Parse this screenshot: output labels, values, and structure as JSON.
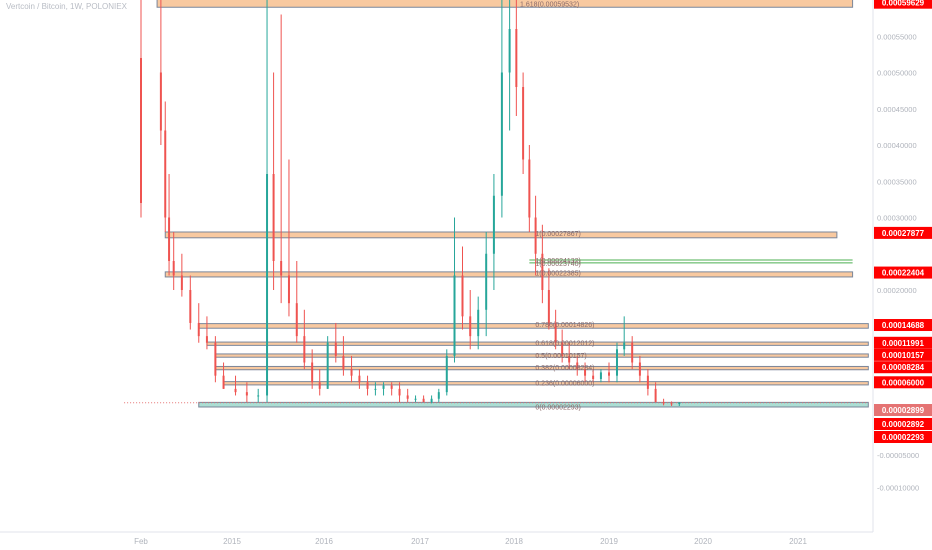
{
  "header": {
    "title": "Vertcoin / Bitcoin, 1W, POLONIEX"
  },
  "colors": {
    "background": "#ffffff",
    "up_candle": "#26a69a",
    "down_candle": "#ef5350",
    "zone_fill": "#f7c08f",
    "zone_border": "#7a869a",
    "support_fill": "#8fd3c4",
    "price_tag": "#ff0000",
    "fib_text": "#8a6a6a",
    "axis_text": "#b0b4bc",
    "grid": "#ffffff"
  },
  "chart_data": {
    "type": "candlestick",
    "title": "Vertcoin / Bitcoin, 1W, POLONIEX",
    "xlabel": "",
    "ylabel": "",
    "grid": false,
    "ylim": [
      -0.00012,
      0.00062
    ],
    "x_ticks": [
      {
        "label": "Feb",
        "date": "2014-02-01"
      },
      {
        "label": "2015",
        "date": "2015-01-01"
      },
      {
        "label": "2016",
        "date": "2016-01-01"
      },
      {
        "label": "2017",
        "date": "2017-01-01"
      },
      {
        "label": "2018",
        "date": "2018-01-01"
      },
      {
        "label": "2019",
        "date": "2019-01-01"
      },
      {
        "label": "2020",
        "date": "2020-01-01"
      },
      {
        "label": "2021",
        "date": "2021-01-01"
      }
    ],
    "y_ticks": [
      {
        "label": "0.00055000",
        "value": 0.00055
      },
      {
        "label": "0.00050000",
        "value": 0.0005
      },
      {
        "label": "0.00045000",
        "value": 0.00045
      },
      {
        "label": "0.00040000",
        "value": 0.0004
      },
      {
        "label": "0.00035000",
        "value": 0.00035
      },
      {
        "label": "0.00030000",
        "value": 0.0003
      },
      {
        "label": "0.00020000",
        "value": 0.0002
      },
      {
        "label": "-0.00005000",
        "value": -5e-05
      },
      {
        "label": "-0.00010000",
        "value": -0.0001
      }
    ],
    "price_tags": [
      {
        "label": "0.00059629",
        "value": 0.00059629,
        "color": "#ff0000"
      },
      {
        "label": "0.00027877",
        "value": 0.00027877,
        "color": "#ff0000"
      },
      {
        "label": "0.00022404",
        "value": 0.00022404,
        "color": "#ff0000"
      },
      {
        "label": "0.00014688",
        "value": 0.00014688,
        "color": "#ff0000"
      },
      {
        "label": "0.00011991",
        "value": 0.00011991,
        "color": "#ff0000"
      },
      {
        "label": "0.00010157",
        "value": 0.00010157,
        "color": "#ff0000"
      },
      {
        "label": "0.00008284",
        "value": 8.284e-05,
        "color": "#ff0000"
      },
      {
        "label": "0.00006000",
        "value": 6e-05,
        "color": "#ff0000"
      },
      {
        "label": "0.00002899",
        "value": 2.899e-05,
        "color": "#e57373"
      },
      {
        "label": "0.00002892",
        "value": 2.892e-05,
        "color": "#ff0000"
      },
      {
        "label": "0.00002293",
        "value": 2.293e-05,
        "color": "#ff0000"
      }
    ],
    "fib_labels": [
      {
        "label": "1.618(0.00059532)",
        "value": 0.00059532,
        "date": "2018-01-01"
      },
      {
        "label": "1(0.00027867)",
        "value": 0.00027867,
        "date": "2018-03-01"
      },
      {
        "label": "1(0.00024132)",
        "value": 0.00024132,
        "date": "2018-03-01"
      },
      {
        "label": "1(0.00023740)",
        "value": 0.0002374,
        "date": "2018-03-01"
      },
      {
        "label": "1(0.00022385)",
        "value": 0.00022385,
        "date": "2018-03-01"
      },
      {
        "label": "0.786(0.00014826)",
        "value": 0.00014826,
        "date": "2018-03-01"
      },
      {
        "label": "0.618(0.00012012)",
        "value": 0.00012012,
        "date": "2018-03-01"
      },
      {
        "label": "0.5(0.00010157)",
        "value": 0.00010157,
        "date": "2018-03-01"
      },
      {
        "label": "0.382(0.00008284)",
        "value": 8.284e-05,
        "date": "2018-03-01"
      },
      {
        "label": "0.236(0.00006000)",
        "value": 6e-05,
        "date": "2018-03-01"
      },
      {
        "label": "0(0.00002293)",
        "value": 2.293e-05,
        "date": "2018-03-01"
      }
    ],
    "zones": [
      {
        "y_top": 0.00062,
        "y_bottom": 0.00059,
        "start": "2014-04-01",
        "end": "2021-08-01",
        "kind": "resistance"
      },
      {
        "y_top": 0.00028,
        "y_bottom": 0.000272,
        "start": "2014-05-01",
        "end": "2021-06-01",
        "kind": "resistance"
      },
      {
        "y_top": 0.000225,
        "y_bottom": 0.000218,
        "start": "2014-05-01",
        "end": "2021-08-01",
        "kind": "resistance"
      },
      {
        "y_top": 0.000149,
        "y_bottom": 0.000142,
        "start": "2014-09-01",
        "end": "2021-10-01",
        "kind": "resistance"
      },
      {
        "y_top": 0.000121,
        "y_bottom": 0.000116,
        "start": "2014-10-01",
        "end": "2021-10-01",
        "kind": "resistance"
      },
      {
        "y_top": 0.000103,
        "y_bottom": 9.8e-05,
        "start": "2014-11-01",
        "end": "2021-10-01",
        "kind": "resistance"
      },
      {
        "y_top": 8.4e-05,
        "y_bottom": 7.9e-05,
        "start": "2014-11-01",
        "end": "2021-10-01",
        "kind": "resistance"
      },
      {
        "y_top": 6.1e-05,
        "y_bottom": 5.6e-05,
        "start": "2014-12-01",
        "end": "2021-10-01",
        "kind": "resistance"
      },
      {
        "y_top": 2.95e-05,
        "y_bottom": 2.25e-05,
        "start": "2014-09-01",
        "end": "2021-10-01",
        "kind": "support"
      }
    ],
    "extra_lines": [
      {
        "value": 0.0002413,
        "start": "2018-03-01",
        "end": "2021-08-01",
        "color": "#4caf50"
      },
      {
        "value": 0.0002374,
        "start": "2018-03-01",
        "end": "2021-08-01",
        "color": "#4caf50"
      },
      {
        "value": 2.899e-05,
        "start": "2013-12-01",
        "end": "2021-10-01",
        "color": "#e57373",
        "dashed": true
      }
    ],
    "series": [
      {
        "date": "2014-02-01",
        "open": 0.00052,
        "high": 0.0006,
        "low": 0.0003,
        "close": 0.00032
      },
      {
        "date": "2014-04-15",
        "open": 0.0005,
        "high": 0.00062,
        "low": 0.0004,
        "close": 0.00042
      },
      {
        "date": "2014-05-01",
        "open": 0.00042,
        "high": 0.00046,
        "low": 0.00028,
        "close": 0.0003
      },
      {
        "date": "2014-05-15",
        "open": 0.0003,
        "high": 0.00036,
        "low": 0.00022,
        "close": 0.00024
      },
      {
        "date": "2014-06-01",
        "open": 0.00024,
        "high": 0.00028,
        "low": 0.0002,
        "close": 0.00022
      },
      {
        "date": "2014-07-01",
        "open": 0.00022,
        "high": 0.00025,
        "low": 0.00019,
        "close": 0.0002
      },
      {
        "date": "2014-08-01",
        "open": 0.0002,
        "high": 0.00022,
        "low": 0.00014,
        "close": 0.00015
      },
      {
        "date": "2014-09-01",
        "open": 0.00015,
        "high": 0.00018,
        "low": 0.00012,
        "close": 0.00013
      },
      {
        "date": "2014-10-01",
        "open": 0.00013,
        "high": 0.00016,
        "low": 0.00011,
        "close": 0.00012
      },
      {
        "date": "2014-11-01",
        "open": 0.00012,
        "high": 0.00013,
        "low": 6e-05,
        "close": 7e-05
      },
      {
        "date": "2014-12-01",
        "open": 7e-05,
        "high": 9e-05,
        "low": 5e-05,
        "close": 5e-05
      },
      {
        "date": "2015-01-15",
        "open": 5e-05,
        "high": 7e-05,
        "low": 4e-05,
        "close": 4.5e-05
      },
      {
        "date": "2015-03-01",
        "open": 4.5e-05,
        "high": 6e-05,
        "low": 3e-05,
        "close": 4e-05
      },
      {
        "date": "2015-04-15",
        "open": 4e-05,
        "high": 5e-05,
        "low": 3e-05,
        "close": 4e-05
      },
      {
        "date": "2015-05-20",
        "open": 4e-05,
        "high": 0.00062,
        "low": 3e-05,
        "close": 0.00036
      },
      {
        "date": "2015-06-15",
        "open": 0.00036,
        "high": 0.0005,
        "low": 0.0002,
        "close": 0.00024
      },
      {
        "date": "2015-07-15",
        "open": 0.00024,
        "high": 0.00058,
        "low": 0.00018,
        "close": 0.00022
      },
      {
        "date": "2015-08-15",
        "open": 0.00022,
        "high": 0.00038,
        "low": 0.00016,
        "close": 0.00018
      },
      {
        "date": "2015-09-15",
        "open": 0.00018,
        "high": 0.00024,
        "low": 0.00012,
        "close": 0.00013
      },
      {
        "date": "2015-10-15",
        "open": 0.00013,
        "high": 0.00017,
        "low": 8e-05,
        "close": 9e-05
      },
      {
        "date": "2015-11-15",
        "open": 9e-05,
        "high": 0.00011,
        "low": 5e-05,
        "close": 6e-05
      },
      {
        "date": "2015-12-15",
        "open": 6e-05,
        "high": 8e-05,
        "low": 4e-05,
        "close": 5e-05
      },
      {
        "date": "2016-01-15",
        "open": 5e-05,
        "high": 0.00013,
        "low": 5e-05,
        "close": 0.00012
      },
      {
        "date": "2016-02-15",
        "open": 0.00012,
        "high": 0.00015,
        "low": 9e-05,
        "close": 0.0001
      },
      {
        "date": "2016-03-15",
        "open": 0.0001,
        "high": 0.00013,
        "low": 7e-05,
        "close": 8e-05
      },
      {
        "date": "2016-04-15",
        "open": 8e-05,
        "high": 0.0001,
        "low": 6e-05,
        "close": 7e-05
      },
      {
        "date": "2016-05-15",
        "open": 7e-05,
        "high": 8e-05,
        "low": 5e-05,
        "close": 6e-05
      },
      {
        "date": "2016-06-15",
        "open": 6e-05,
        "high": 7e-05,
        "low": 4e-05,
        "close": 5e-05
      },
      {
        "date": "2016-07-15",
        "open": 5e-05,
        "high": 6e-05,
        "low": 4e-05,
        "close": 5e-05
      },
      {
        "date": "2016-08-15",
        "open": 5e-05,
        "high": 6e-05,
        "low": 4e-05,
        "close": 5.5e-05
      },
      {
        "date": "2016-09-15",
        "open": 5.5e-05,
        "high": 6e-05,
        "low": 4e-05,
        "close": 5e-05
      },
      {
        "date": "2016-10-15",
        "open": 5e-05,
        "high": 6e-05,
        "low": 3e-05,
        "close": 4e-05
      },
      {
        "date": "2016-11-15",
        "open": 4e-05,
        "high": 5e-05,
        "low": 3e-05,
        "close": 3.5e-05
      },
      {
        "date": "2016-12-15",
        "open": 3.5e-05,
        "high": 4e-05,
        "low": 3e-05,
        "close": 3.5e-05
      },
      {
        "date": "2017-01-15",
        "open": 3.5e-05,
        "high": 4e-05,
        "low": 3e-05,
        "close": 3e-05
      },
      {
        "date": "2017-02-15",
        "open": 3e-05,
        "high": 4e-05,
        "low": 2.8e-05,
        "close": 3.5e-05
      },
      {
        "date": "2017-03-15",
        "open": 3.5e-05,
        "high": 5e-05,
        "low": 3e-05,
        "close": 4.5e-05
      },
      {
        "date": "2017-04-15",
        "open": 4.5e-05,
        "high": 0.00011,
        "low": 4e-05,
        "close": 0.0001
      },
      {
        "date": "2017-05-15",
        "open": 0.0001,
        "high": 0.0003,
        "low": 9e-05,
        "close": 0.00022
      },
      {
        "date": "2017-06-15",
        "open": 0.00022,
        "high": 0.00026,
        "low": 0.00014,
        "close": 0.00016
      },
      {
        "date": "2017-07-15",
        "open": 0.00016,
        "high": 0.0002,
        "low": 0.00011,
        "close": 0.00013
      },
      {
        "date": "2017-08-15",
        "open": 0.00013,
        "high": 0.00019,
        "low": 0.00011,
        "close": 0.00017
      },
      {
        "date": "2017-09-15",
        "open": 0.00017,
        "high": 0.00028,
        "low": 0.00013,
        "close": 0.00025
      },
      {
        "date": "2017-10-15",
        "open": 0.00025,
        "high": 0.00036,
        "low": 0.0002,
        "close": 0.00033
      },
      {
        "date": "2017-11-15",
        "open": 0.00033,
        "high": 0.00062,
        "low": 0.0003,
        "close": 0.0005
      },
      {
        "date": "2017-12-15",
        "open": 0.0005,
        "high": 0.00062,
        "low": 0.00042,
        "close": 0.00056
      },
      {
        "date": "2018-01-10",
        "open": 0.00056,
        "high": 0.00062,
        "low": 0.00044,
        "close": 0.00048
      },
      {
        "date": "2018-02-05",
        "open": 0.00048,
        "high": 0.0005,
        "low": 0.00036,
        "close": 0.00038
      },
      {
        "date": "2018-03-01",
        "open": 0.00038,
        "high": 0.0004,
        "low": 0.00028,
        "close": 0.0003
      },
      {
        "date": "2018-03-25",
        "open": 0.0003,
        "high": 0.00033,
        "low": 0.00022,
        "close": 0.00025
      },
      {
        "date": "2018-04-20",
        "open": 0.00025,
        "high": 0.00029,
        "low": 0.00018,
        "close": 0.0002
      },
      {
        "date": "2018-05-15",
        "open": 0.0002,
        "high": 0.00023,
        "low": 0.00014,
        "close": 0.00015
      },
      {
        "date": "2018-06-10",
        "open": 0.00015,
        "high": 0.00017,
        "low": 0.00011,
        "close": 0.00012
      },
      {
        "date": "2018-07-05",
        "open": 0.00012,
        "high": 0.00014,
        "low": 9e-05,
        "close": 0.0001
      },
      {
        "date": "2018-08-01",
        "open": 0.0001,
        "high": 0.00012,
        "low": 8e-05,
        "close": 9e-05
      },
      {
        "date": "2018-09-01",
        "open": 9e-05,
        "high": 0.0001,
        "low": 7e-05,
        "close": 8e-05
      },
      {
        "date": "2018-10-01",
        "open": 8e-05,
        "high": 9e-05,
        "low": 6e-05,
        "close": 7e-05
      },
      {
        "date": "2018-11-01",
        "open": 7e-05,
        "high": 8e-05,
        "low": 6e-05,
        "close": 6.5e-05
      },
      {
        "date": "2018-12-01",
        "open": 6.5e-05,
        "high": 8e-05,
        "low": 6e-05,
        "close": 7.5e-05
      },
      {
        "date": "2019-01-01",
        "open": 7.5e-05,
        "high": 9e-05,
        "low": 6e-05,
        "close": 7e-05
      },
      {
        "date": "2019-02-01",
        "open": 7e-05,
        "high": 0.00012,
        "low": 6e-05,
        "close": 0.00011
      },
      {
        "date": "2019-03-01",
        "open": 0.00011,
        "high": 0.00016,
        "low": 0.0001,
        "close": 0.00012
      },
      {
        "date": "2019-04-01",
        "open": 0.00012,
        "high": 0.00013,
        "low": 8e-05,
        "close": 9e-05
      },
      {
        "date": "2019-05-01",
        "open": 9e-05,
        "high": 0.0001,
        "low": 6e-05,
        "close": 7e-05
      },
      {
        "date": "2019-06-01",
        "open": 7e-05,
        "high": 8e-05,
        "low": 4e-05,
        "close": 5e-05
      },
      {
        "date": "2019-07-01",
        "open": 5e-05,
        "high": 6e-05,
        "low": 3e-05,
        "close": 3e-05
      },
      {
        "date": "2019-08-01",
        "open": 3e-05,
        "high": 3.5e-05,
        "low": 2.5e-05,
        "close": 2.8e-05
      },
      {
        "date": "2019-09-01",
        "open": 2.8e-05,
        "high": 3.1e-05,
        "low": 2.4e-05,
        "close": 2.7e-05
      },
      {
        "date": "2019-10-01",
        "open": 2.7e-05,
        "high": 3e-05,
        "low": 2.4e-05,
        "close": 2.9e-05
      }
    ]
  }
}
